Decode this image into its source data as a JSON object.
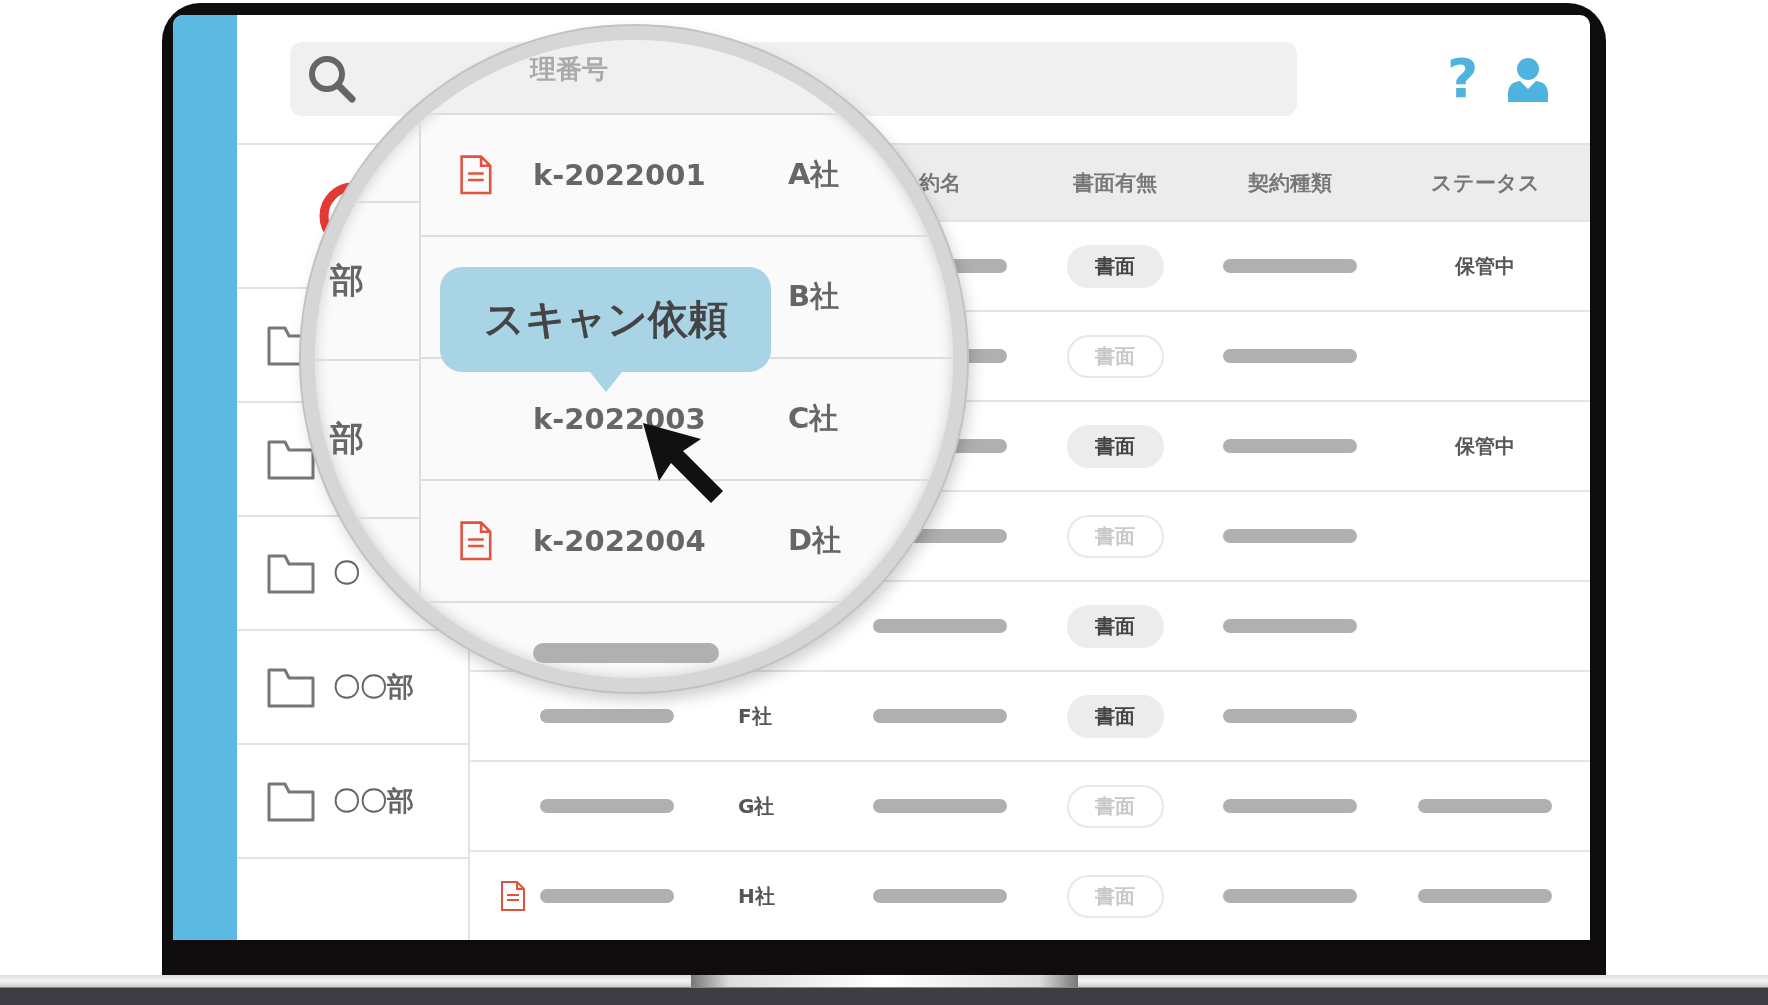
{
  "screen": {
    "help_icon": "?",
    "sidebar": {
      "items": [
        {
          "kind": "badge"
        },
        {
          "kind": "folder"
        },
        {
          "kind": "folder"
        },
        {
          "kind": "folder",
          "label": "〇"
        },
        {
          "kind": "folder",
          "label": "〇〇部"
        },
        {
          "kind": "folder",
          "label": "〇〇部"
        }
      ]
    },
    "table": {
      "columns": [
        null,
        null,
        "約名",
        "書面有無",
        "契約種類",
        "ステータス"
      ],
      "rows": [
        {
          "cells": [
            null,
            null,
            {
              "kind": "bar"
            },
            {
              "kind": "tag",
              "text": "書面",
              "filled": true
            },
            {
              "kind": "bar"
            },
            {
              "kind": "text",
              "text": "保管中"
            }
          ]
        },
        {
          "cells": [
            null,
            null,
            {
              "kind": "bar"
            },
            {
              "kind": "tag",
              "text": "書面",
              "filled": false
            },
            {
              "kind": "bar"
            },
            null
          ]
        },
        {
          "cells": [
            null,
            null,
            {
              "kind": "bar"
            },
            {
              "kind": "tag",
              "text": "書面",
              "filled": true
            },
            {
              "kind": "bar"
            },
            {
              "kind": "text",
              "text": "保管中"
            }
          ]
        },
        {
          "cells": [
            null,
            null,
            {
              "kind": "bar"
            },
            {
              "kind": "tag",
              "text": "書面",
              "filled": false
            },
            {
              "kind": "bar"
            },
            null
          ]
        },
        {
          "cells": [
            null,
            null,
            {
              "kind": "bar"
            },
            {
              "kind": "tag",
              "text": "書面",
              "filled": true
            },
            {
              "kind": "bar"
            },
            null
          ]
        },
        {
          "cells": [
            {
              "kind": "bar"
            },
            {
              "kind": "text",
              "text": "F社"
            },
            {
              "kind": "bar"
            },
            {
              "kind": "tag",
              "text": "書面",
              "filled": true
            },
            {
              "kind": "bar"
            },
            null
          ]
        },
        {
          "cells": [
            {
              "kind": "bar"
            },
            {
              "kind": "text",
              "text": "G社"
            },
            {
              "kind": "bar"
            },
            {
              "kind": "tag",
              "text": "書面",
              "filled": false
            },
            {
              "kind": "bar"
            },
            {
              "kind": "bar"
            }
          ]
        },
        {
          "cells": [
            {
              "kind": "doc-bar"
            },
            {
              "kind": "text",
              "text": "H社"
            },
            {
              "kind": "bar"
            },
            {
              "kind": "tag",
              "text": "書面",
              "filled": false
            },
            {
              "kind": "bar"
            },
            {
              "kind": "bar"
            }
          ]
        }
      ]
    },
    "lens": {
      "search_text": "理番号",
      "sidebar": [
        "部",
        "部"
      ],
      "rows": [
        {
          "document": true,
          "id": "k-2022001",
          "company": "A社",
          "bar": false
        },
        {
          "company": "B社"
        },
        {
          "document": false,
          "id": "k-2022003",
          "company": "C社",
          "bar": false
        },
        {
          "document": true,
          "id": "k-2022004",
          "company": "D社",
          "bar": false
        },
        {
          "document": false,
          "bar": true
        }
      ],
      "tooltip": "スキャン依頼"
    }
  }
}
